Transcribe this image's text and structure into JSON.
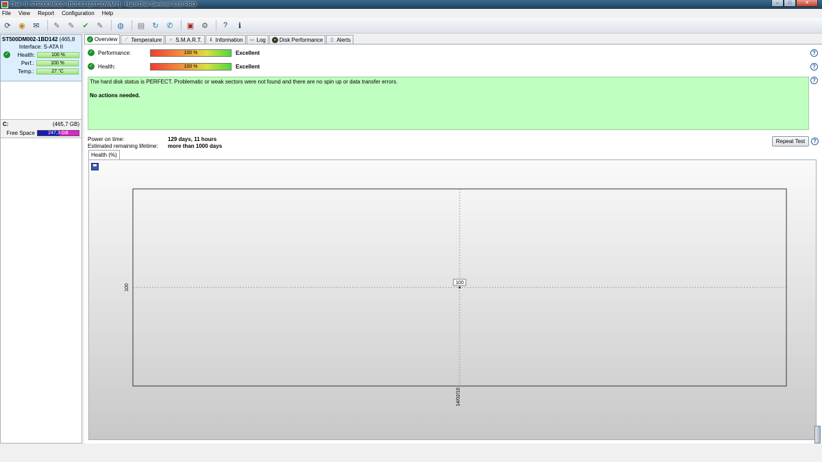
{
  "window": {
    "title": "Disk: 0, ST500DM002-1BD142 [Z3T2DWMY]  -  Hard Disk Sentinel 3.00 PRO"
  },
  "menu": [
    "File",
    "View",
    "Report",
    "Configuration",
    "Help"
  ],
  "toolbar_icons": [
    "refresh-icon",
    "surface-test-icon",
    "report-icon",
    "disk-tool-icon",
    "disk-tool-icon-2",
    "disk-ok-icon",
    "disk-tool-icon-3",
    "web-icon",
    "clipboard-icon",
    "update-icon",
    "message-icon",
    "notebook-icon",
    "settings-icon",
    "help-icon",
    "info-icon"
  ],
  "disk": {
    "name": "ST500DM002-1BD142",
    "size": "(465,8",
    "interface_label": "Interface:",
    "interface": "S-ATA II",
    "health_label": "Health:",
    "health": "100 %",
    "perf_label": "Perf.:",
    "perf": "100 %",
    "temp_label": "Temp.:",
    "temp": "27 °C"
  },
  "volume": {
    "letter": "C:",
    "size": "(465,7 GB)",
    "free_label": "Free Space",
    "free": "247,3 GB",
    "free_fraction": 0.53
  },
  "tabs": [
    {
      "label": "Overview",
      "icon": "check-icon"
    },
    {
      "label": "Temperature",
      "icon": "thermometer-icon"
    },
    {
      "label": "S.M.A.R.T.",
      "icon": "smart-icon"
    },
    {
      "label": "Information",
      "icon": "info-icon"
    },
    {
      "label": "Log",
      "icon": "log-icon"
    },
    {
      "label": "Disk Performance",
      "icon": "performance-icon"
    },
    {
      "label": "Alerts",
      "icon": "alert-icon"
    }
  ],
  "overview": {
    "performance_label": "Performance:",
    "performance_value": "100 %",
    "performance_rating": "Excellent",
    "health_label": "Health:",
    "health_value": "100 %",
    "health_rating": "Excellent",
    "status_text": "The hard disk status is PERFECT. Problematic or weak sectors were not found and there are no spin up or data transfer errors.",
    "action_text": "No actions needed.",
    "power_on_label": "Power on time:",
    "power_on_value": "129 days, 11 hours",
    "lifetime_label": "Estimated remaining lifetime:",
    "lifetime_value": "more than 1000 days",
    "repeat_button": "Repeat Test",
    "subtab_label": "Health (%)"
  },
  "chart_data": {
    "type": "line",
    "x": [
      "14/02/10"
    ],
    "series": [
      {
        "values": [
          100
        ]
      }
    ],
    "data_labels": [
      "100"
    ],
    "ytick_labels": [
      "100"
    ],
    "xtick_labels": [
      "14/02/10"
    ],
    "grid": true
  }
}
